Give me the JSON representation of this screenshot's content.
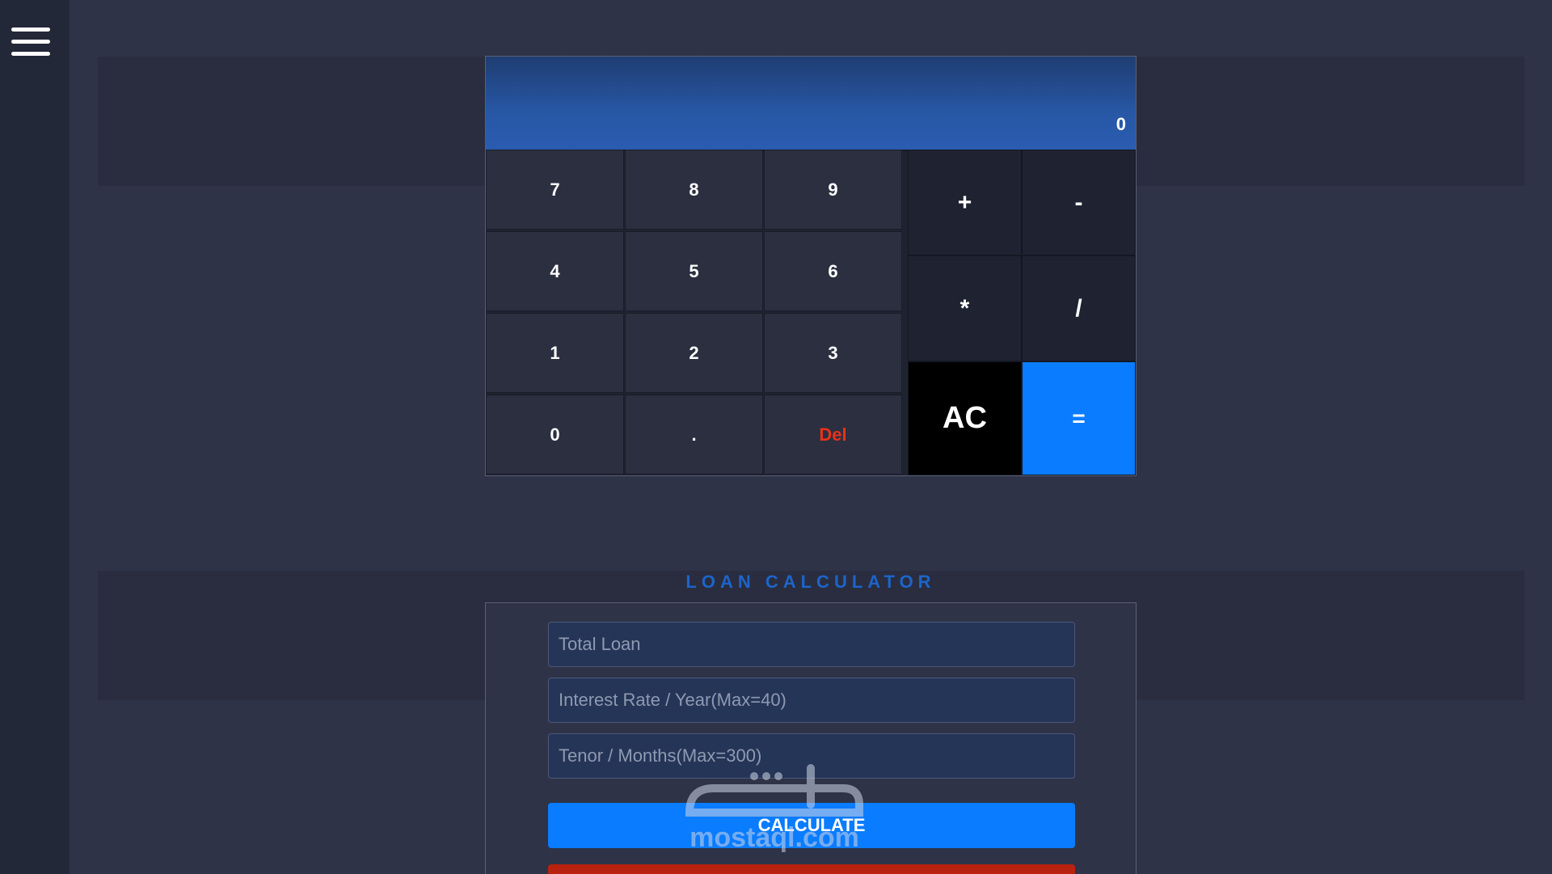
{
  "sidebar": {
    "menu_icon": "hamburger-menu-icon"
  },
  "calculator": {
    "display_value": "0",
    "number_keys": [
      [
        "7",
        "8",
        "9"
      ],
      [
        "4",
        "5",
        "6"
      ],
      [
        "1",
        "2",
        "3"
      ],
      [
        "0",
        ".",
        "Del"
      ]
    ],
    "operator_keys": [
      [
        "+",
        "-"
      ],
      [
        "*",
        "/"
      ],
      [
        "AC",
        "="
      ]
    ],
    "colors": {
      "del": "#e8321a",
      "equals": "#0a7cff",
      "ac": "#000000"
    }
  },
  "loan": {
    "title": "LOAN CALCULATOR",
    "total_loan_placeholder": "Total Loan",
    "interest_placeholder": "Interest Rate / Year(Max=40)",
    "tenor_placeholder": "Tenor / Months(Max=300)",
    "calculate_label": "CALCULATE",
    "colors": {
      "title": "#1d64c9",
      "calculate": "#0a7cff",
      "second_button": "#b8220f"
    }
  },
  "watermark": {
    "text": "mostaql.com",
    "logo": "mostaql-logo"
  }
}
